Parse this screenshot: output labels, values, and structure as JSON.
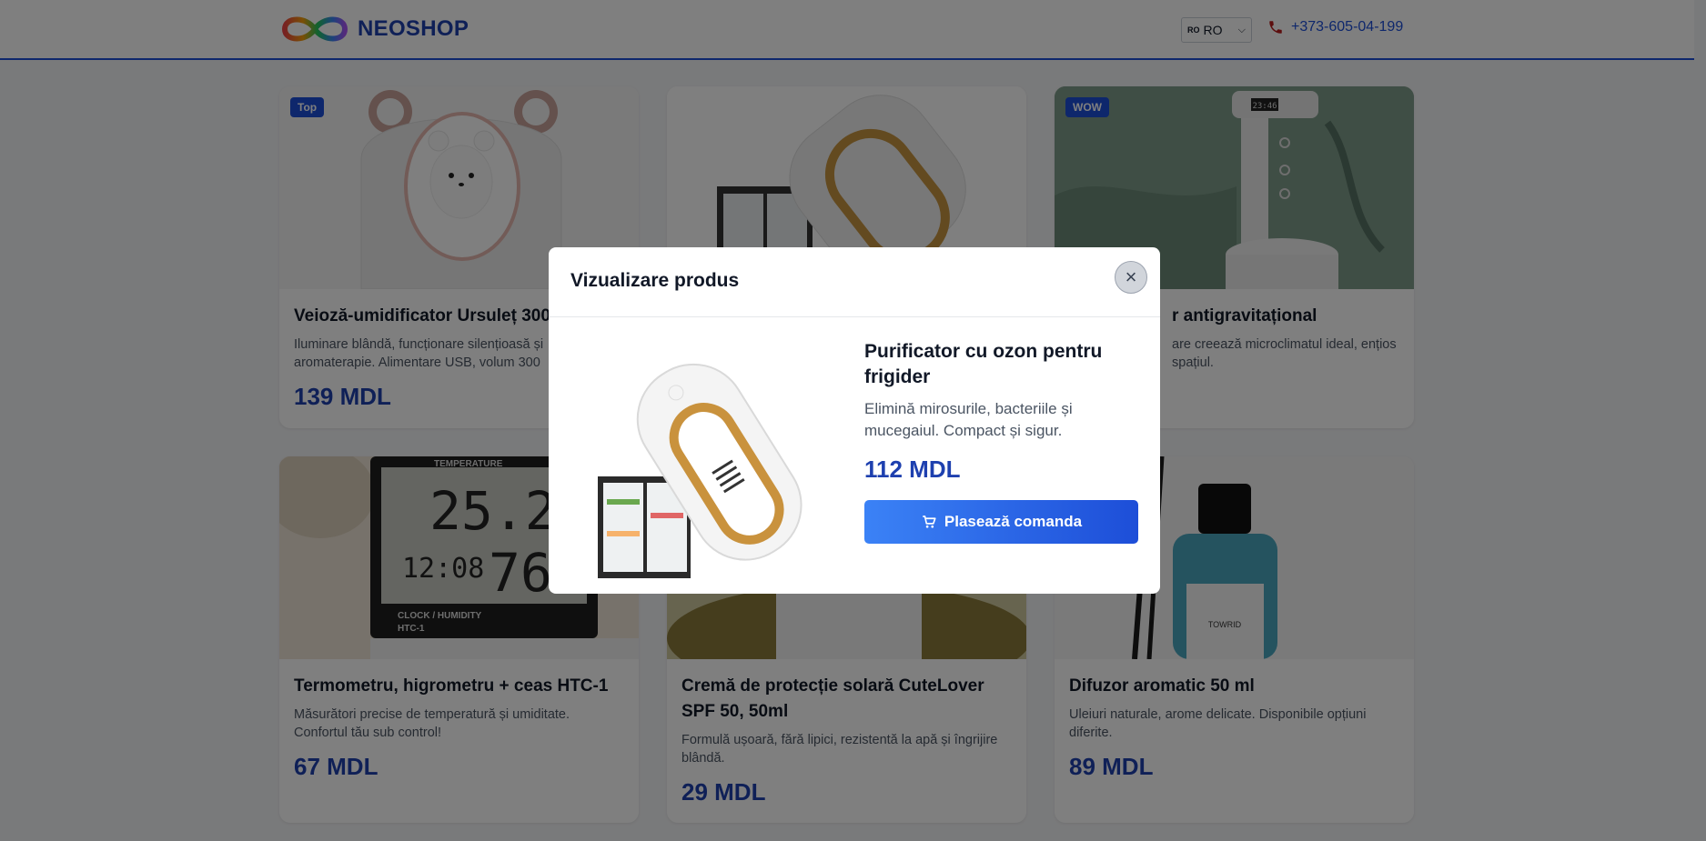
{
  "header": {
    "brand": "NEOSHOP",
    "language": {
      "flag": "RO",
      "selected": "RO"
    },
    "phone": "+373-605-04-199"
  },
  "products": [
    {
      "badge": "Top",
      "title": "Veioză-umidificator Ursuleț 300",
      "description": "Iluminare blândă, funcționare silențioasă și aromaterapie. Alimentare USB, volum 300",
      "price": "139 MDL"
    },
    {
      "badge": "",
      "title": "",
      "description": "",
      "price": ""
    },
    {
      "badge": "WOW",
      "title": "r antigravitațional",
      "description": "are creează microclimatul ideal, ențios spațiul.",
      "price": ""
    },
    {
      "badge": "",
      "title": "Termometru, higrometru + ceas HTC-1",
      "description": "Măsurători precise de temperatură și umiditate. Confortul tău sub control!",
      "price": "67 MDL"
    },
    {
      "badge": "",
      "title": "Cremă de protecție solară CuteLover SPF 50, 50ml",
      "description": "Formulă ușoară, fără lipici, rezistentă la apă și îngrijire blândă.",
      "price": "29 MDL"
    },
    {
      "badge": "",
      "title": "Difuzor aromatic 50 ml",
      "description": "Uleiuri naturale, arome delicate. Disponibile opțiuni diferite.",
      "price": "89 MDL"
    }
  ],
  "thermometer": {
    "brand": "TEMPERATURE",
    "temp": "25.2",
    "time": "12:08",
    "humidity": "76%",
    "model_line1": "CLOCK / HUMIDITY",
    "model_line2": "HTC-1"
  },
  "humidifier_display": "23:46",
  "diffuser_label": "TOWRID",
  "modal": {
    "title": "Vizualizare produs",
    "close_icon": "×",
    "product_name": "Purificator cu ozon pentru frigider",
    "product_description": "Elimină mirosurile, bacteriile și mucegaiul. Compact și sigur.",
    "product_price": "112 MDL",
    "order_label": "Plasează comanda"
  },
  "colors": {
    "accent": "#1d4ed8",
    "price": "#1e40af"
  }
}
